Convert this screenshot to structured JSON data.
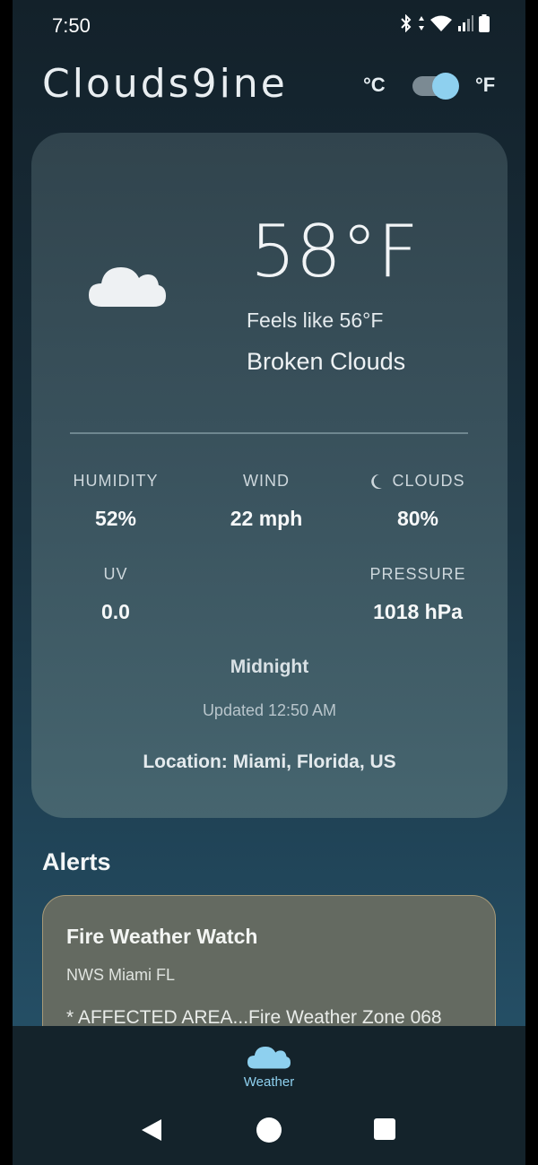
{
  "status_bar": {
    "time": "7:50"
  },
  "header": {
    "title": "Clouds9ine",
    "unit_c": "°C",
    "unit_f": "°F",
    "selected_unit": "F"
  },
  "current": {
    "icon": "cloud-icon",
    "temperature": "58°F",
    "feels_like": "Feels like 56°F",
    "condition": "Broken Clouds"
  },
  "stats": {
    "humidity": {
      "label": "HUMIDITY",
      "value": "52%"
    },
    "wind": {
      "label": "WIND",
      "value": "22 mph"
    },
    "clouds": {
      "label": "CLOUDS",
      "value": "80%",
      "icon": "moon-icon"
    },
    "uv": {
      "label": "UV",
      "value": "0.0"
    },
    "pressure": {
      "label": "PRESSURE",
      "value": "1018 hPa"
    }
  },
  "time_of_day": "Midnight",
  "updated": "Updated 12:50 AM",
  "location": "Location: Miami, Florida, US",
  "alerts": {
    "title": "Alerts",
    "items": [
      {
        "title": "Fire Weather Watch",
        "source": "NWS Miami FL",
        "body": "* AFFECTED AREA...Fire Weather Zone 068"
      }
    ]
  },
  "bottom_nav": {
    "items": [
      {
        "label": "Weather",
        "icon": "cloud-icon"
      }
    ]
  },
  "colors": {
    "accent": "#8ed0ef",
    "card": "#3a535e",
    "alert_card": "#646a61"
  }
}
